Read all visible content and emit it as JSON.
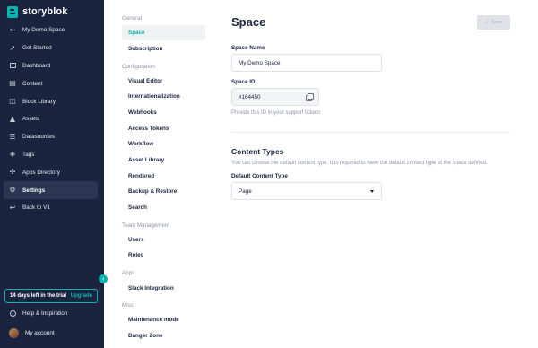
{
  "brand": {
    "name": "storyblok"
  },
  "sidebar": {
    "items": [
      {
        "label": "My Demo Space",
        "icon": "arrow-left-icon"
      },
      {
        "label": "Get Started",
        "icon": "rocket-icon"
      },
      {
        "label": "Dashboard",
        "icon": "dashboard-icon"
      },
      {
        "label": "Content",
        "icon": "content-icon"
      },
      {
        "label": "Block Library",
        "icon": "block-library-icon"
      },
      {
        "label": "Assets",
        "icon": "assets-icon"
      },
      {
        "label": "Datasources",
        "icon": "datasources-icon"
      },
      {
        "label": "Tags",
        "icon": "tag-icon"
      },
      {
        "label": "Apps Directory",
        "icon": "apps-icon"
      },
      {
        "label": "Settings",
        "icon": "gear-icon",
        "active": true
      },
      {
        "label": "Back to V1",
        "icon": "back-icon"
      }
    ],
    "trial": {
      "text": "14 days left in the trial",
      "upgrade": "Upgrade"
    },
    "help": "Help & Inspiration",
    "account": "My account"
  },
  "subnav": {
    "groups": [
      {
        "heading": "General",
        "items": [
          "Space",
          "Subscription"
        ]
      },
      {
        "heading": "Configuration",
        "items": [
          "Visual Editor",
          "Internationalization",
          "Webhooks",
          "Access Tokens",
          "Workflow",
          "Asset Library",
          "Rendered",
          "Backup & Restore",
          "Search"
        ]
      },
      {
        "heading": "Team Management",
        "items": [
          "Users",
          "Roles"
        ]
      },
      {
        "heading": "Apps",
        "items": [
          "Slack Integration"
        ]
      },
      {
        "heading": "Misc",
        "items": [
          "Maintenance mode",
          "Danger Zone"
        ]
      }
    ],
    "active": "Space"
  },
  "main": {
    "title": "Space",
    "save_label": "Save",
    "space_name": {
      "label": "Space Name",
      "value": "My Demo Space"
    },
    "space_id": {
      "label": "Space ID",
      "value": "#164450",
      "help": "Provide this ID in your support tickets"
    },
    "content_types": {
      "title": "Content Types",
      "description": "You can choose the default content type. It is required to have the default content type of the space defined.",
      "default_label": "Default Content Type",
      "default_value": "Page"
    }
  },
  "colors": {
    "sidebar_bg": "#1b243f",
    "accent": "#09b3af",
    "text": "#1b243f",
    "muted": "#8d93a8"
  }
}
